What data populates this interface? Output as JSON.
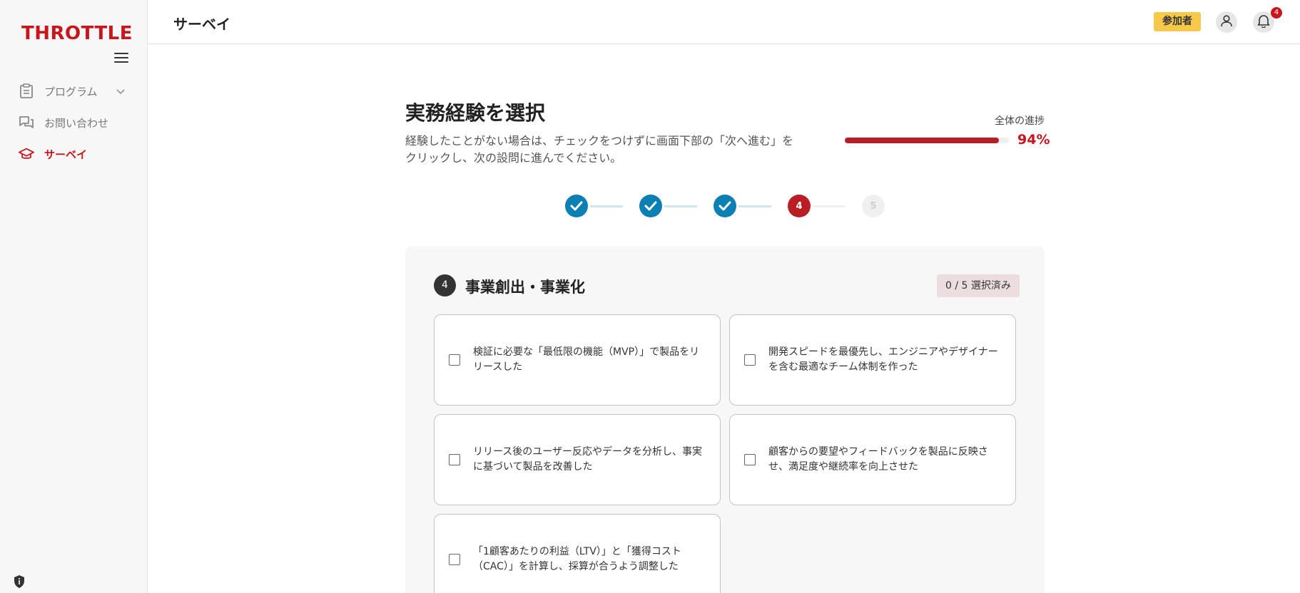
{
  "app": {
    "logo_text": "THROTTLE"
  },
  "sidebar": {
    "items": [
      {
        "label": "プログラム",
        "icon": "clipboard-icon",
        "active": false,
        "has_chevron": true
      },
      {
        "label": "お問い合わせ",
        "icon": "chat-icon",
        "active": false,
        "has_chevron": false
      },
      {
        "label": "サーベイ",
        "icon": "graduation-cap-icon",
        "active": true,
        "has_chevron": false
      }
    ]
  },
  "header": {
    "title": "サーベイ",
    "role_badge": "参加者",
    "notification_count": "4"
  },
  "main": {
    "title": "実務経験を選択",
    "description": "経験したことがない場合は、チェックをつけずに画面下部の「次へ進む」をクリックし、次の設問に進んでください。",
    "progress": {
      "label": "全体の進捗",
      "percent_text": "94%",
      "value": 0.94
    },
    "steps": [
      {
        "label": "1",
        "state": "done"
      },
      {
        "label": "2",
        "state": "done"
      },
      {
        "label": "3",
        "state": "done"
      },
      {
        "label": "4",
        "state": "current"
      },
      {
        "label": "5",
        "state": "todo"
      }
    ],
    "section": {
      "number": "4",
      "title": "事業創出・事業化",
      "selected_count": "0 / 5 選択済み",
      "options": [
        {
          "text": "検証に必要な「最低限の機能（MVP）」で製品をリリースした",
          "checked": false
        },
        {
          "text": "開発スピードを最優先し、エンジニアやデザイナーを含む最適なチーム体制を作った",
          "checked": false
        },
        {
          "text": "リリース後のユーザー反応やデータを分析し、事実に基づいて製品を改善した",
          "checked": false
        },
        {
          "text": "顧客からの要望やフィードバックを製品に反映させ、満足度や継続率を向上させた",
          "checked": false
        },
        {
          "text": "「1顧客あたりの利益（LTV）」と「獲得コスト（CAC）」を計算し、採算が合うよう調整した",
          "checked": false
        }
      ]
    }
  },
  "colors": {
    "brand": "#c8161d",
    "step_done": "#0c7fb5",
    "badge": "#f7c94a"
  }
}
